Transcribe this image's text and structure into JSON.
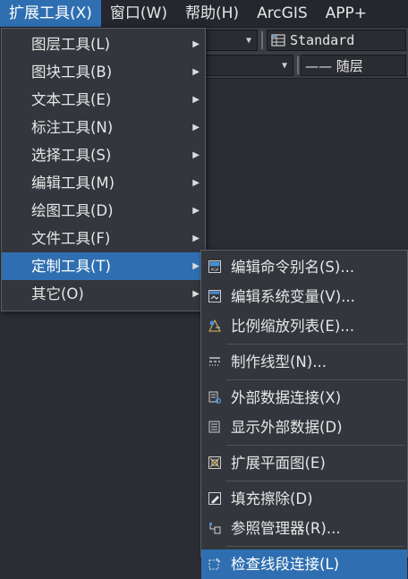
{
  "menubar": {
    "items": [
      {
        "label": "扩展工具(X)"
      },
      {
        "label": "窗口(W)"
      },
      {
        "label": "帮助(H)"
      },
      {
        "label": "ArcGIS"
      },
      {
        "label": "APP+"
      }
    ]
  },
  "toolbar": {
    "style_combo": "Standard",
    "layer_combo": "—— 随层"
  },
  "menu": {
    "items": [
      {
        "label": "图层工具(L)"
      },
      {
        "label": "图块工具(B)"
      },
      {
        "label": "文本工具(E)"
      },
      {
        "label": "标注工具(N)"
      },
      {
        "label": "选择工具(S)"
      },
      {
        "label": "编辑工具(M)"
      },
      {
        "label": "绘图工具(D)"
      },
      {
        "label": "文件工具(F)"
      },
      {
        "label": "定制工具(T)"
      },
      {
        "label": "其它(O)"
      }
    ]
  },
  "submenu": {
    "items": [
      {
        "label": "编辑命令别名(S)...",
        "icon": "pgp-file-icon"
      },
      {
        "label": "编辑系统变量(V)...",
        "icon": "variables-icon"
      },
      {
        "label": "比例缩放列表(E)...",
        "icon": "scale-list-icon"
      },
      {
        "label": "制作线型(N)...",
        "icon": "linetype-icon"
      },
      {
        "label": "外部数据连接(X)",
        "icon": "data-link-icon"
      },
      {
        "label": "显示外部数据(D)",
        "icon": "show-data-icon"
      },
      {
        "label": "扩展平面图(E)",
        "icon": "expand-plan-icon"
      },
      {
        "label": "填充擦除(D)",
        "icon": "hatch-erase-icon"
      },
      {
        "label": "参照管理器(R)...",
        "icon": "reference-manager-icon"
      },
      {
        "label": "检查线段连接(L)",
        "icon": "check-segment-icon"
      }
    ]
  }
}
